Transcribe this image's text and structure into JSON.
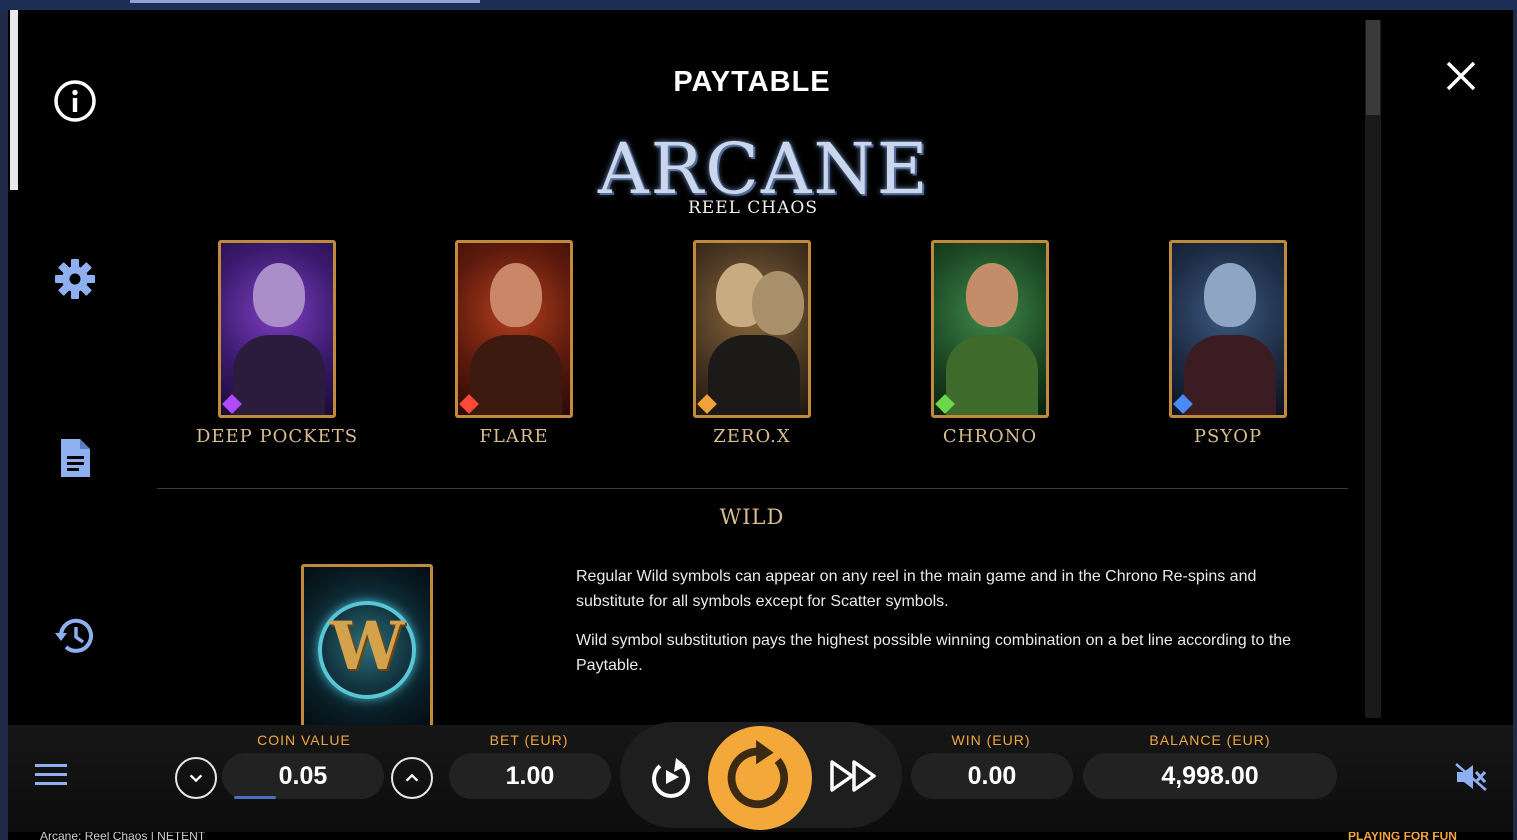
{
  "paytable": {
    "title": "PAYTABLE",
    "logo": {
      "main": "ARCANE",
      "sub": "REEL CHAOS"
    },
    "symbols": [
      {
        "name": "DEEP POCKETS"
      },
      {
        "name": "FLARE"
      },
      {
        "name": "ZERO.X"
      },
      {
        "name": "CHRONO"
      },
      {
        "name": "PSYOP"
      }
    ],
    "wild": {
      "title": "WILD",
      "card_letter": "W",
      "paragraphs": [
        "Regular Wild symbols can appear on any reel in the main game and in the Chrono Re-spins and substitute for all symbols except for Scatter symbols.",
        "Wild symbol substitution pays the highest possible winning combination on a bet line according to the Paytable."
      ]
    }
  },
  "sidebar": {
    "icons": [
      "info-icon",
      "gear-icon",
      "document-icon",
      "history-icon"
    ]
  },
  "controls": {
    "coin_value": {
      "label": "COIN VALUE",
      "value": "0.05"
    },
    "bet": {
      "label": "BET (EUR)",
      "value": "1.00"
    },
    "win": {
      "label": "WIN (EUR)",
      "value": "0.00"
    },
    "balance": {
      "label": "BALANCE (EUR)",
      "value": "4,998.00"
    }
  },
  "footer": {
    "left": "Arcane: Reel Chaos | NETENT",
    "right": "PLAYING FOR FUN"
  },
  "colors": {
    "accent": "#f5a83a",
    "gold_text": "#d8bd8f",
    "frame_border": "#c08a3c",
    "background": "#000000"
  }
}
